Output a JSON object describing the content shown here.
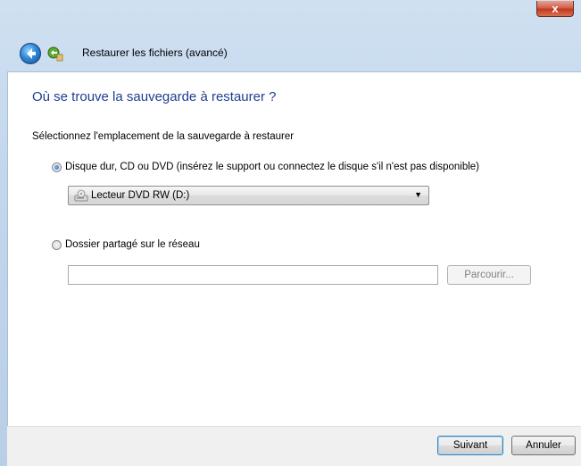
{
  "window": {
    "title": "Restaurer les fichiers (avancé)",
    "close_label": "x"
  },
  "page": {
    "heading": "Où se trouve la sauvegarde à restaurer ?",
    "instruction": "Sélectionnez l'emplacement de la sauvegarde à restaurer"
  },
  "options": {
    "disk": {
      "label": "Disque dur, CD ou DVD (insérez le support ou connectez le disque s'il n'est pas disponible)",
      "selected": true,
      "dropdown_value": "Lecteur DVD RW (D:)",
      "dropdown_arrow": "▼"
    },
    "network": {
      "label": "Dossier partagé sur le réseau",
      "selected": false,
      "path_value": "",
      "browse_label": "Parcourir..."
    }
  },
  "footer": {
    "next_label": "Suivant",
    "cancel_label": "Annuler"
  },
  "icons": {
    "back": "back-arrow-icon",
    "app": "restore-files-icon",
    "drive": "dvd-drive-icon"
  }
}
